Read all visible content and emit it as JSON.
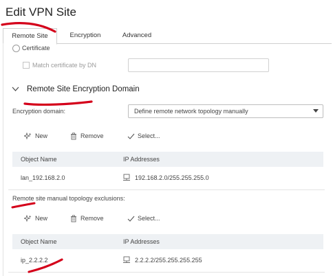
{
  "dialog": {
    "title": "Edit VPN Site"
  },
  "tabs": [
    {
      "label": "Remote Site",
      "active": true
    },
    {
      "label": "Encryption",
      "active": false
    },
    {
      "label": "Advanced",
      "active": false
    }
  ],
  "auth": {
    "certificate_label": "Certificate",
    "match_dn_label": "Match certificate by DN",
    "match_dn_value": ""
  },
  "encryption_domain_section": {
    "title": "Remote Site Encryption Domain",
    "domain_label": "Encryption domain:",
    "domain_value": "Define remote network topology manually"
  },
  "toolbar": {
    "new_label": "New",
    "remove_label": "Remove",
    "select_label": "Select..."
  },
  "table_headers": [
    "Object Name",
    "IP Addresses"
  ],
  "topology_table": {
    "rows": [
      {
        "name": "lan_192.168.2.0",
        "ip": "192.168.2.0/255.255.255.0"
      }
    ]
  },
  "exclusions": {
    "label": "Remote site manual topology exclusions:",
    "rows": [
      {
        "name": "ip_2.2.2.2",
        "ip": "2.2.2.2/255.255.255.255"
      }
    ]
  },
  "colors": {
    "annotation": "#d4001a",
    "header_bg": "#eef1f4",
    "border": "#cfcfcf"
  }
}
